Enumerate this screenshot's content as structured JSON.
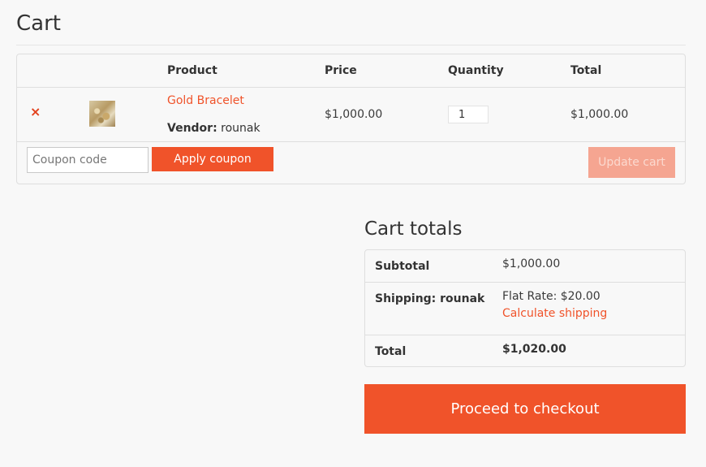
{
  "page": {
    "title": "Cart"
  },
  "cart": {
    "headers": {
      "product": "Product",
      "price": "Price",
      "quantity": "Quantity",
      "total": "Total"
    },
    "items": [
      {
        "remove_symbol": "×",
        "thumbnail_icon": "gold-bracelet-thumbnail",
        "name": "Gold Bracelet",
        "vendor_label": "Vendor:",
        "vendor_name": "rounak",
        "price": "$1,000.00",
        "quantity": "1",
        "total": "$1,000.00"
      }
    ],
    "coupon": {
      "placeholder": "Coupon code",
      "apply_label": "Apply coupon"
    },
    "update_label": "Update cart"
  },
  "totals": {
    "title": "Cart totals",
    "subtotal_label": "Subtotal",
    "subtotal_value": "$1,000.00",
    "shipping_label": "Shipping: rounak",
    "shipping_value": "Flat Rate: $20.00",
    "calculate_shipping": "Calculate shipping",
    "total_label": "Total",
    "total_value": "$1,020.00",
    "checkout_label": "Proceed to checkout"
  },
  "colors": {
    "accent": "#f0532a",
    "accent_disabled": "#f5a591",
    "remove": "#e2401c",
    "background": "#f8f8f8",
    "border": "#dedede"
  }
}
